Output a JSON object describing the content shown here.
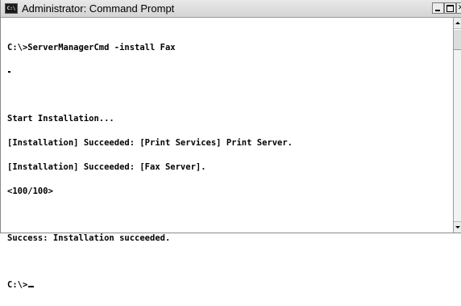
{
  "window": {
    "title": "Administrator: Command Prompt",
    "icon_label": "C:\\",
    "icon_name": "console-window-icon",
    "minimize_icon": "minimize-icon",
    "maximize_icon": "maximize-icon",
    "close_icon": "close-icon"
  },
  "console": {
    "lines": [
      "C:\\>ServerManagerCmd -install Fax",
      "",
      "Start Installation...",
      "[Installation] Succeeded: [Print Services] Print Server.",
      "[Installation] Succeeded: [Fax Server].",
      "<100/100>",
      "Success: Installation succeeded.",
      "C:\\>"
    ]
  }
}
